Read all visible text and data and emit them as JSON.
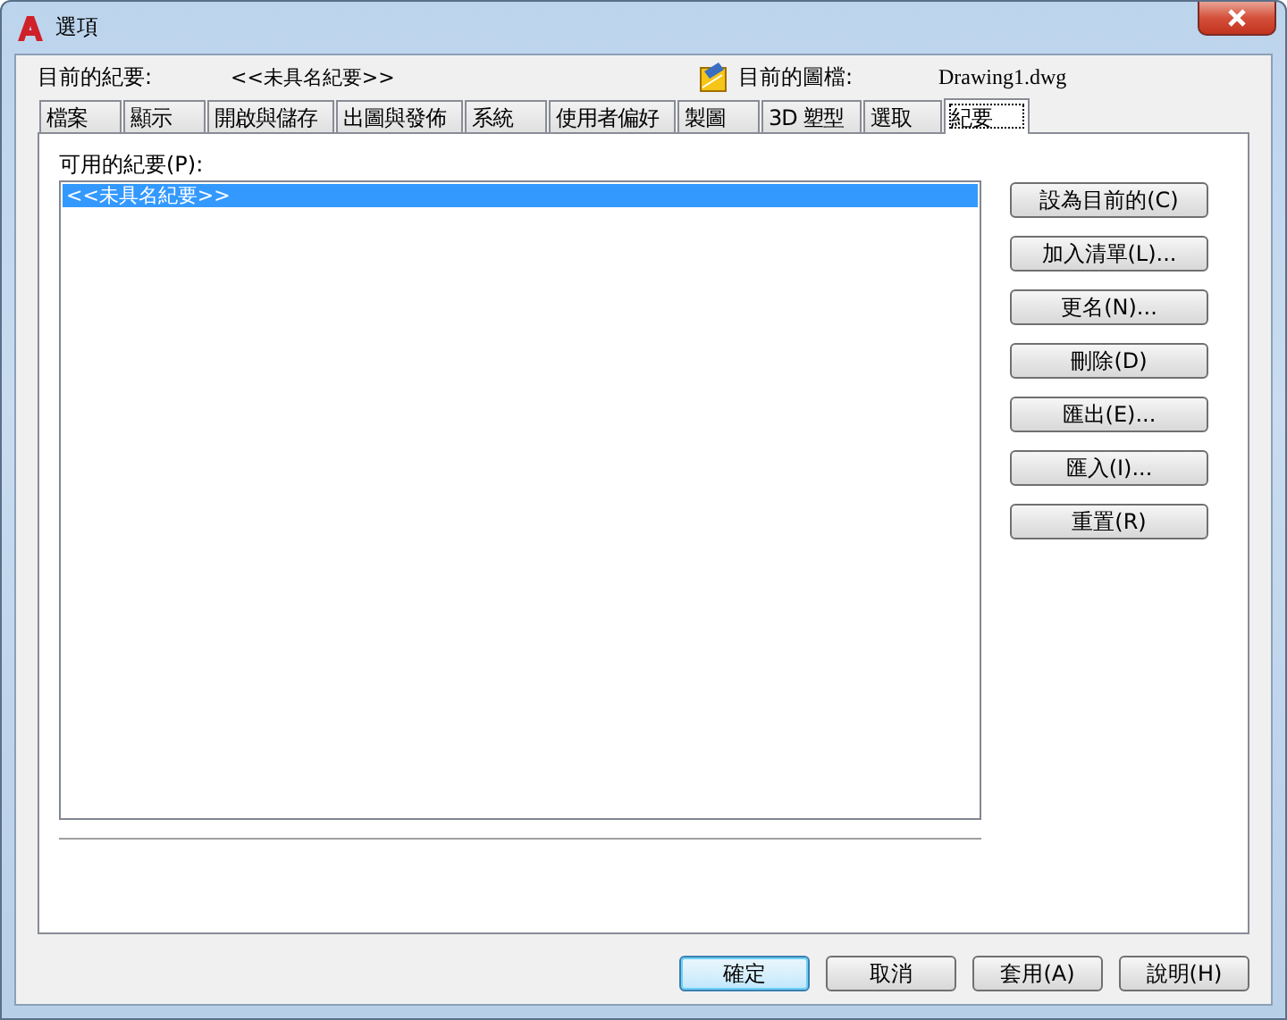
{
  "window": {
    "title": "選項"
  },
  "header": {
    "profile_label": "目前的紀要:",
    "profile_value": "<<未具名紀要>>",
    "drawing_label": "目前的圖檔:",
    "drawing_value": "Drawing1.dwg"
  },
  "tabs": [
    {
      "label": "檔案",
      "selected": false
    },
    {
      "label": "顯示",
      "selected": false
    },
    {
      "label": "開啟與儲存",
      "selected": false
    },
    {
      "label": "出圖與發佈",
      "selected": false
    },
    {
      "label": "系統",
      "selected": false
    },
    {
      "label": "使用者偏好",
      "selected": false
    },
    {
      "label": "製圖",
      "selected": false
    },
    {
      "label": "3D 塑型",
      "selected": false
    },
    {
      "label": "選取",
      "selected": false
    },
    {
      "label": "紀要",
      "selected": true
    }
  ],
  "profiles": {
    "label": "可用的紀要(P):",
    "items": [
      {
        "name": "<<未具名紀要>>",
        "selected": true
      }
    ]
  },
  "side_buttons": [
    "設為目前的(C)",
    "加入清單(L)...",
    "更名(N)...",
    "刪除(D)",
    "匯出(E)...",
    "匯入(I)...",
    "重置(R)"
  ],
  "footer_buttons": [
    {
      "label": "確定",
      "default": true
    },
    {
      "label": "取消",
      "default": false
    },
    {
      "label": "套用(A)",
      "default": false
    },
    {
      "label": "說明(H)",
      "default": false
    }
  ]
}
